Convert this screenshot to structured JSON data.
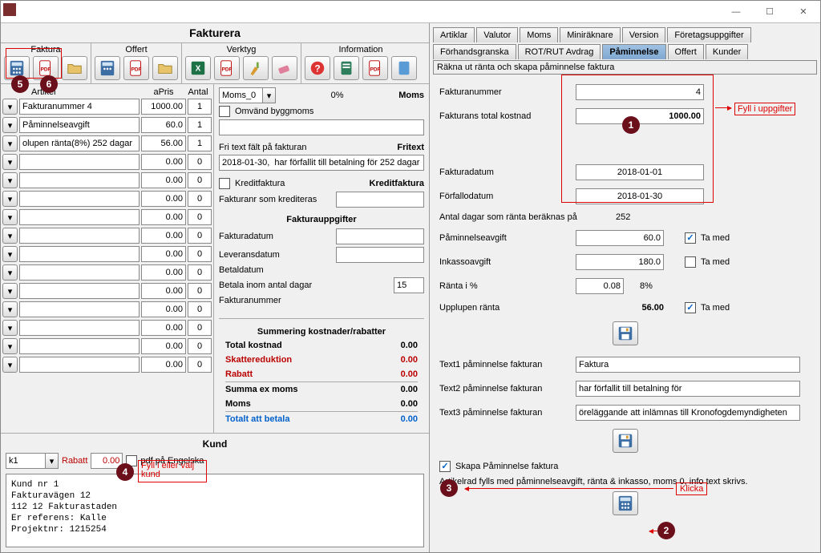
{
  "window": {
    "min": "—",
    "max": "☐",
    "close": "✕"
  },
  "sectionTitle": "Fakturera",
  "toolGroups": {
    "faktura": "Faktura",
    "offert": "Offert",
    "verktyg": "Verktyg",
    "information": "Information"
  },
  "lineHead": {
    "artikel": "Artikel",
    "apris": "aPris",
    "antal": "Antal"
  },
  "lines": [
    {
      "art": "Fakturanummer 4",
      "pris": "1000.00",
      "ant": "1"
    },
    {
      "art": "Påminnelseavgift",
      "pris": "60.0",
      "ant": "1"
    },
    {
      "art": "olupen ränta(8%) 252 dagar",
      "pris": "56.00",
      "ant": "1"
    },
    {
      "art": "",
      "pris": "0.00",
      "ant": "0"
    },
    {
      "art": "",
      "pris": "0.00",
      "ant": "0"
    },
    {
      "art": "",
      "pris": "0.00",
      "ant": "0"
    },
    {
      "art": "",
      "pris": "0.00",
      "ant": "0"
    },
    {
      "art": "",
      "pris": "0.00",
      "ant": "0"
    },
    {
      "art": "",
      "pris": "0.00",
      "ant": "0"
    },
    {
      "art": "",
      "pris": "0.00",
      "ant": "0"
    },
    {
      "art": "",
      "pris": "0.00",
      "ant": "0"
    },
    {
      "art": "",
      "pris": "0.00",
      "ant": "0"
    },
    {
      "art": "",
      "pris": "0.00",
      "ant": "0"
    },
    {
      "art": "",
      "pris": "0.00",
      "ant": "0"
    },
    {
      "art": "",
      "pris": "0.00",
      "ant": "0"
    }
  ],
  "moms": {
    "label": "Moms",
    "combo": "Moms_0",
    "percent": "0%",
    "omvand": "Omvänd byggmoms"
  },
  "fritext": {
    "label1": "Fri text fält på fakturan",
    "label2": "Fritext",
    "value": "2018-01-30,  har förfallit till betalning för 252 dagar sedan."
  },
  "kredit": {
    "chkLabel": "Kreditfaktura",
    "title": "Kreditfaktura",
    "fnr": "Fakturanr som krediteras"
  },
  "fupp": {
    "title": "Fakturauppgifter",
    "fakturadatum": "Fakturadatum",
    "leveransdatum": "Leveransdatum",
    "betaldatum": "Betaldatum",
    "betalaInom": "Betala inom antal dagar",
    "betalaInomVal": "15",
    "fakturanummer": "Fakturanummer"
  },
  "summary": {
    "title": "Summering kostnader/rabatter",
    "total": "Total kostnad",
    "totalV": "0.00",
    "skatt": "Skattereduktion",
    "skattV": "0.00",
    "rabatt": "Rabatt",
    "rabattV": "0.00",
    "summaEx": "Summa ex moms",
    "summaExV": "0.00",
    "moms": "Moms",
    "momsV": "0.00",
    "totalt": "Totalt att betala",
    "totaltV": "0.00"
  },
  "kund": {
    "title": "Kund",
    "sel": "k1",
    "rabattLbl": "Rabatt",
    "rabattVal": "0.00",
    "pdfEng": "pdf på Engelska",
    "text": "Kund nr 1\nFakturavägen 12\n112 12 Fakturastaden\nEr referens: Kalle\nProjektnr: 1215254"
  },
  "tabs": {
    "row1": [
      "Artiklar",
      "Valutor",
      "Moms",
      "Miniräknare",
      "Version",
      "Företagsuppgifter"
    ],
    "row2": [
      "Förhandsgranska",
      "ROT/RUT Avdrag",
      "Påminnelse",
      "Offert",
      "Kunder"
    ],
    "active": "Påminnelse",
    "body": "Räkna ut ränta och skapa påminnelse faktura"
  },
  "reminder": {
    "fakturanummer": "Fakturanummer",
    "fakturanummerV": "4",
    "totalKost": "Fakturans total kostnad",
    "totalKostV": "1000.00",
    "fakturadatum": "Fakturadatum",
    "fakturadatumV": "2018-01-01",
    "forfallo": "Förfallodatum",
    "forfalloV": "2018-01-30",
    "antalDagar": "Antal dagar som ränta beräknas på",
    "antalDagarV": "252",
    "paminnAvg": "Påminnelseavgift",
    "paminnAvgV": "60.0",
    "inkasso": "Inkassoavgift",
    "inkassoV": "180.0",
    "ranta": "Ränta i %",
    "rantaV": "0.08",
    "rantaPct": "8%",
    "upplupen": "Upplupen ränta",
    "upplupenV": "56.00",
    "taMed": "Ta med",
    "text1Lbl": "Text1 påminnelse fakturan",
    "text1V": "Faktura",
    "text2Lbl": "Text2 påminnelse fakturan",
    "text2V": "har förfallit till betalning för",
    "text3Lbl": "Text3 påminnelse fakturan",
    "text3V": "öreläggande att inlämnas till Kronofogdemyndigheten",
    "skapa": "Skapa Påminnelse faktura",
    "artikelrad": "Artikelrad fylls med påminnelseavgift, ränta & inkasso, moms 0, info text skrivs."
  },
  "annot": {
    "fyll1": "Fyll i uppgifter",
    "fyllKund": "Fyll i eller välj kund",
    "klicka": "Klicka",
    "b1": "1",
    "b2": "2",
    "b3": "3",
    "b4": "4",
    "b5": "5",
    "b6": "6"
  }
}
